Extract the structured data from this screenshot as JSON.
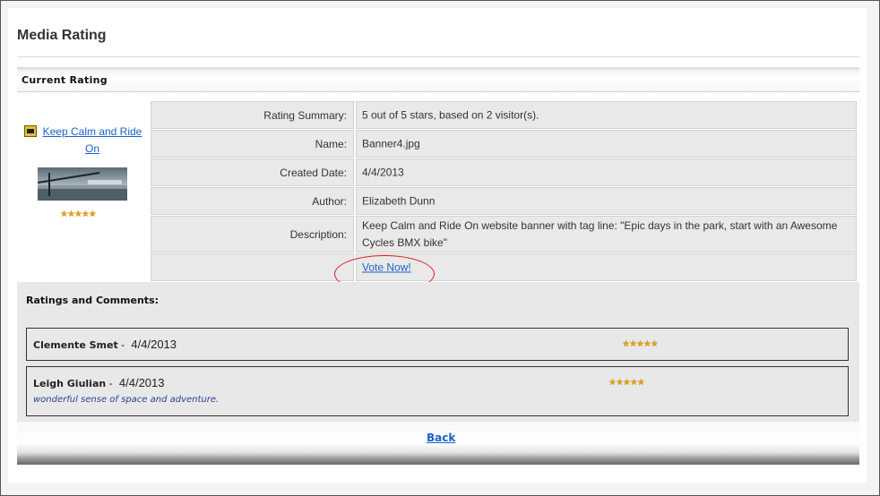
{
  "page": {
    "title": "Media Rating"
  },
  "current_rating": {
    "header": "Current Rating",
    "media": {
      "link_text": "Keep Calm and Ride On",
      "icon": "image-file-icon",
      "rating_stars": 5,
      "star_glyphs": "★★★★★"
    },
    "details": [
      {
        "label": "Rating Summary:",
        "value": "5 out of 5 stars, based on 2 visitor(s)."
      },
      {
        "label": "Name:",
        "value": "Banner4.jpg"
      },
      {
        "label": "Created Date:",
        "value": "4/4/2013"
      },
      {
        "label": "Author:",
        "value": "Elizabeth Dunn"
      },
      {
        "label": "Description:",
        "value": "Keep Calm and Ride On website banner with tag line: \"Epic days in the park, start with an Awesome Cycles BMX bike\""
      }
    ],
    "vote_label": "Vote Now!",
    "highlight_color": "#e21b1b"
  },
  "ratings_and_comments": {
    "title": "Ratings and Comments:",
    "entries": [
      {
        "name": "Clemente Smet",
        "separator": "-",
        "date": "4/4/2013",
        "stars": 5,
        "star_glyphs": "★★★★★",
        "comment": ""
      },
      {
        "name": "Leigh Giulian",
        "separator": "-",
        "date": "4/4/2013",
        "stars": 5,
        "star_glyphs": "★★★★★",
        "comment": "wonderful sense of space and adventure."
      }
    ]
  },
  "footer": {
    "back_label": "Back"
  },
  "colors": {
    "link": "#1a62c8",
    "star": "#e0a01a",
    "comment_text": "#2a3f9c",
    "panel": "#e9e9e9"
  }
}
